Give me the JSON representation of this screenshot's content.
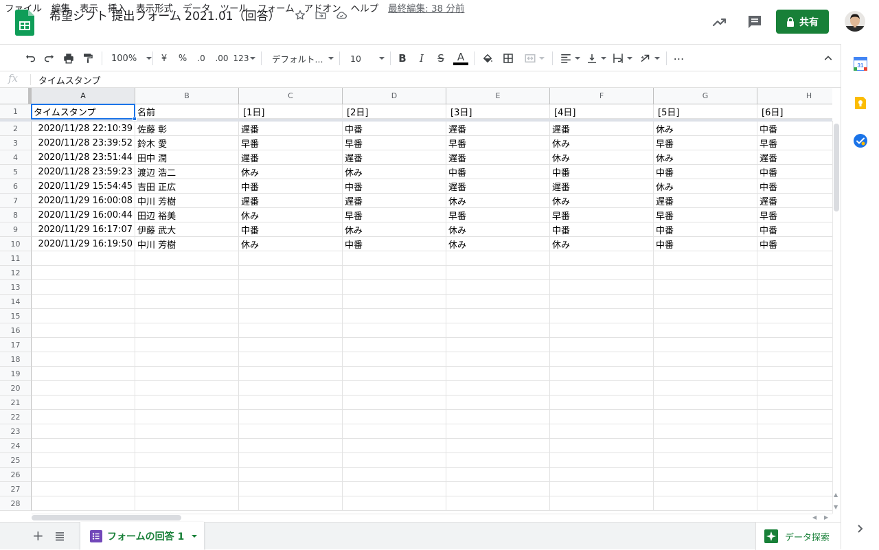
{
  "doc": {
    "title": "希望シフト 提出フォーム 2021.01（回答）",
    "last_edit": "最終編集: 38 分前",
    "share_label": "共有"
  },
  "menu": [
    "ファイル",
    "編集",
    "表示",
    "挿入",
    "表示形式",
    "データ",
    "ツール",
    "フォーム",
    "アドオン",
    "ヘルプ"
  ],
  "toolbar": {
    "zoom": "100%",
    "currency": "¥",
    "percent": "%",
    "decimal_decrease": ".0",
    "decimal_increase": ".00",
    "number_format": "123",
    "font": "デフォルト...",
    "font_size": "10"
  },
  "formula_bar": {
    "fx": "fx",
    "value": "タイムスタンプ"
  },
  "columns": [
    "A",
    "B",
    "C",
    "D",
    "E",
    "F",
    "G",
    "H"
  ],
  "header_row": [
    "タイムスタンプ",
    "名前",
    "[1日]",
    "[2日]",
    "[3日]",
    "[4日]",
    "[5日]",
    "[6日]"
  ],
  "rows": [
    [
      "2020/11/28 22:10:39",
      "佐藤 彰",
      "遅番",
      "中番",
      "遅番",
      "遅番",
      "休み",
      "中番"
    ],
    [
      "2020/11/28 23:39:52",
      "鈴木 愛",
      "早番",
      "早番",
      "早番",
      "休み",
      "早番",
      "早番"
    ],
    [
      "2020/11/28 23:51:44",
      "田中 潤",
      "遅番",
      "遅番",
      "遅番",
      "休み",
      "休み",
      "遅番"
    ],
    [
      "2020/11/28 23:59:23",
      "渡辺 浩二",
      "休み",
      "休み",
      "中番",
      "中番",
      "中番",
      "中番"
    ],
    [
      "2020/11/29 15:54:45",
      "吉田 正広",
      "中番",
      "中番",
      "遅番",
      "遅番",
      "休み",
      "中番"
    ],
    [
      "2020/11/29 16:00:08",
      "中川 芳樹",
      "遅番",
      "遅番",
      "休み",
      "休み",
      "遅番",
      "遅番"
    ],
    [
      "2020/11/29 16:00:44",
      "田辺 裕美",
      "休み",
      "早番",
      "早番",
      "早番",
      "早番",
      "早番"
    ],
    [
      "2020/11/29 16:17:07",
      "伊藤 武大",
      "中番",
      "休み",
      "休み",
      "中番",
      "中番",
      "中番"
    ],
    [
      "2020/11/29 16:19:50",
      "中川 芳樹",
      "休み",
      "中番",
      "休み",
      "休み",
      "中番",
      "中番"
    ]
  ],
  "row_numbers": [
    "1",
    "2",
    "3",
    "4",
    "5",
    "6",
    "7",
    "8",
    "9",
    "10",
    "11",
    "12",
    "13",
    "14",
    "15",
    "16",
    "17",
    "18",
    "19",
    "20",
    "21",
    "22",
    "23",
    "24",
    "25",
    "26",
    "27",
    "28"
  ],
  "bottom": {
    "add_sheet": "+",
    "sheet_tab": "フォームの回答 1",
    "explore": "データ探索"
  },
  "colors": {
    "share_green": "#188038",
    "selection_blue": "#1a73e8",
    "header_bg": "#f8f9fa"
  }
}
